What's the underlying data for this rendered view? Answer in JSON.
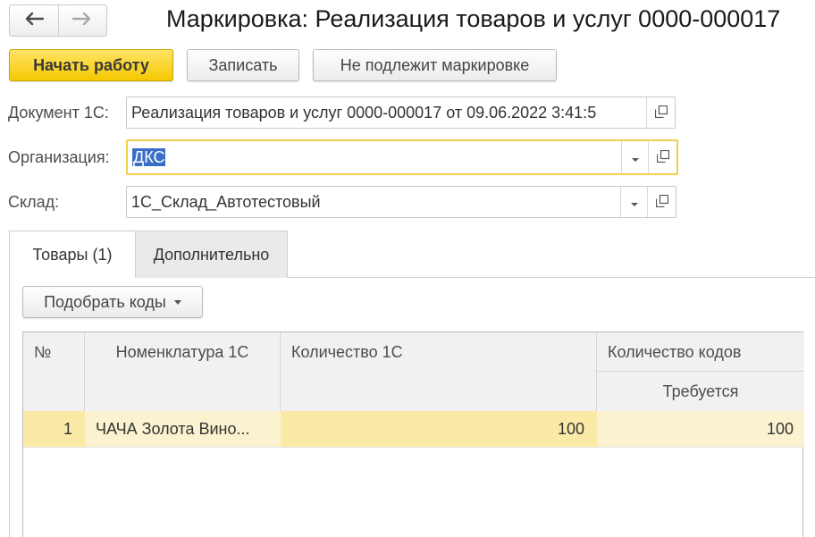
{
  "window": {
    "title": "Маркировка: Реализация товаров и услуг 0000-000017"
  },
  "toolbar": {
    "start_label": "Начать работу",
    "save_label": "Записать",
    "not_subject_label": "Не подлежит маркировке"
  },
  "form": {
    "document": {
      "label": "Документ 1С:",
      "value": "Реализация товаров и услуг 0000-000017 от 09.06.2022 3:41:5"
    },
    "organization": {
      "label": "Организация:",
      "value": "ДКС"
    },
    "warehouse": {
      "label": "Склад:",
      "value": "1С_Склад_Автотестовый"
    }
  },
  "tabs": [
    {
      "label": "Товары (1)",
      "active": true
    },
    {
      "label": "Дополнительно",
      "active": false
    }
  ],
  "pick_codes_label": "Подобрать коды",
  "table": {
    "headers": {
      "num": "№",
      "nomenclature": "Номенклатура 1С",
      "quantity": "Количество 1С",
      "codes_group": "Количество кодов",
      "required": "Требуется"
    },
    "rows": [
      {
        "num": "1",
        "nomenclature": "ЧАЧА Золота Вино...",
        "quantity": "100",
        "required": "100"
      }
    ]
  },
  "colors": {
    "accent": "#f5c800",
    "row_highlight": "#fbf3cf",
    "row_cell_highlight": "#faeaa6",
    "focus_border": "#f0d050",
    "selection": "#3b6fc7"
  }
}
